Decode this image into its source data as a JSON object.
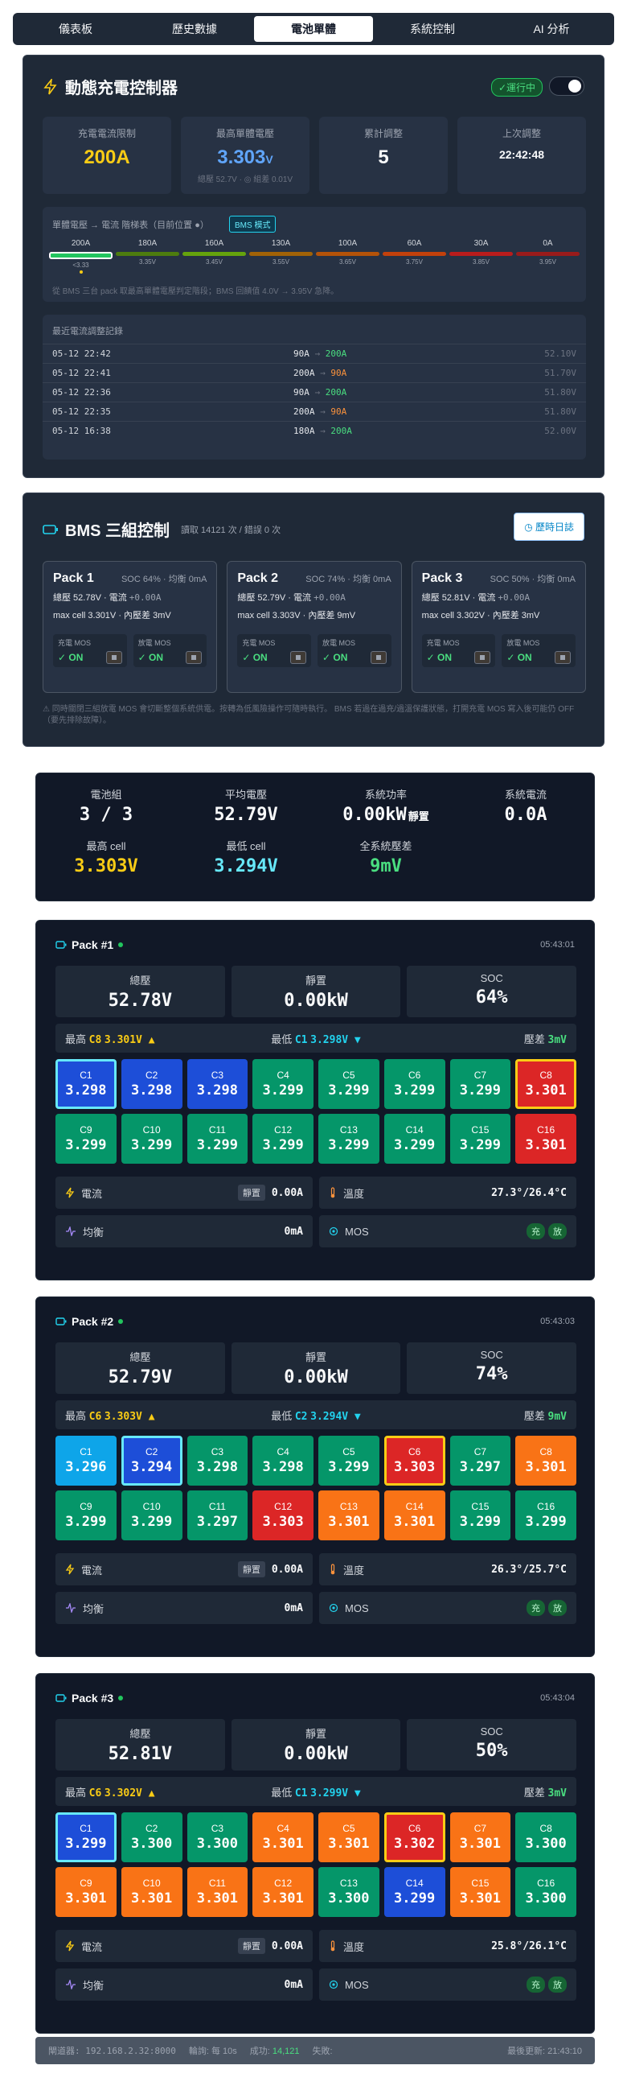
{
  "nav": {
    "tabs": [
      "儀表板",
      "歷史數據",
      "電池單體",
      "系統控制",
      "AI 分析"
    ],
    "active": 2
  },
  "charge": {
    "title": "動態充電控制器",
    "status": "✓運行中",
    "stats": [
      {
        "label": "充電電流限制",
        "value": "200A",
        "color": "#facc15",
        "sub": ""
      },
      {
        "label": "最高單體電壓",
        "value": "3.303",
        "unit": "V",
        "color": "#60a5fa",
        "sub": "總壓 52.7V · ◎ 組差 0.01V"
      },
      {
        "label": "累計調整",
        "value": "5",
        "color": "#f9fafb",
        "sub": ""
      },
      {
        "label": "上次調整",
        "value": "22:42:48",
        "color": "#f9fafb",
        "sub": ""
      }
    ],
    "ladder_title": "單體電壓 → 電流 階梯表（目前位置 ●）",
    "ladder_badge": "BMS 模式",
    "ladder": [
      {
        "a": "200A",
        "v": "<3.33",
        "color": "#22c55e",
        "cur": true
      },
      {
        "a": "180A",
        "v": "3.35V",
        "color": "#4d7c0f"
      },
      {
        "a": "160A",
        "v": "3.45V",
        "color": "#65a30d"
      },
      {
        "a": "130A",
        "v": "3.55V",
        "color": "#a16207"
      },
      {
        "a": "100A",
        "v": "3.65V",
        "color": "#b45309"
      },
      {
        "a": "60A",
        "v": "3.75V",
        "color": "#c2410c"
      },
      {
        "a": "30A",
        "v": "3.85V",
        "color": "#b91c1c"
      },
      {
        "a": "0A",
        "v": "3.95V",
        "color": "#991b1b"
      }
    ],
    "ladder_note": "從 BMS 三台 pack 取最高單體電壓判定階段；BMS 回饋值 4.0V → 3.95V 急降。",
    "log_title": "最近電流調整記錄",
    "log": [
      {
        "d": "05-12 22:42",
        "from": "90A",
        "to": "200A",
        "to_color": "#4ade80",
        "v": "52.10V"
      },
      {
        "d": "05-12 22:41",
        "from": "200A",
        "to": "90A",
        "to_color": "#fb923c",
        "v": "51.70V"
      },
      {
        "d": "05-12 22:36",
        "from": "90A",
        "to": "200A",
        "to_color": "#4ade80",
        "v": "51.80V"
      },
      {
        "d": "05-12 22:35",
        "from": "200A",
        "to": "90A",
        "to_color": "#fb923c",
        "v": "51.80V"
      },
      {
        "d": "05-12 16:38",
        "from": "180A",
        "to": "200A",
        "to_color": "#4ade80",
        "v": "52.00V"
      }
    ]
  },
  "bms": {
    "title": "BMS 三組控制",
    "sub": "讀取 14121 次 / 錯誤 0 次",
    "history_btn": "◷ 歷時日誌",
    "packs": [
      {
        "name": "Pack 1",
        "soc": "SOC 64% · 均衡 0mA",
        "l1a": "總壓 52.78V · 電流 ",
        "l1b": "+0.00A",
        "l2": "max cell 3.301V · 內壓差 3mV"
      },
      {
        "name": "Pack 2",
        "soc": "SOC 74% · 均衡 0mA",
        "l1a": "總壓 52.79V · 電流 ",
        "l1b": "+0.00A",
        "l2": "max cell 3.303V · 內壓差 9mV"
      },
      {
        "name": "Pack 3",
        "soc": "SOC 50% · 均衡 0mA",
        "l1a": "總壓 52.81V · 電流 ",
        "l1b": "+0.00A",
        "l2": "max cell 3.302V · 內壓差 3mV"
      }
    ],
    "mos_charge": "充電 MOS",
    "mos_discharge": "放電 MOS",
    "mos_on": "✓ ON",
    "warning": "⚠ 同時關閉三組放電 MOS 會切斷整個系統供電。按轉為低風險操作可隨時執行。 BMS 若過在過充/過溫保護狀態，打開充電 MOS 寫入後可能仍 OFF（要先排除故障）。"
  },
  "summary": [
    {
      "label": "電池組",
      "value": "3 / 3",
      "color": "#f9fafb"
    },
    {
      "label": "平均電壓",
      "value": "52.79V",
      "color": "#f9fafb"
    },
    {
      "label": "系統功率",
      "value": "0.00kW",
      "tag": "靜置",
      "color": "#f9fafb"
    },
    {
      "label": "系統電流",
      "value": "0.0A",
      "color": "#f9fafb"
    },
    {
      "label": "最高 cell",
      "value": "3.303V",
      "color": "#facc15"
    },
    {
      "label": "最低 cell",
      "value": "3.294V",
      "color": "#67e8f9"
    },
    {
      "label": "全系統壓差",
      "value": "9mV",
      "color": "#4ade80"
    }
  ],
  "labels": {
    "total_v": "總壓",
    "power": "靜置",
    "soc": "SOC",
    "max": "最高",
    "min": "最低",
    "diff": "壓差",
    "current": "電流",
    "idle": "靜置",
    "temp": "溫度",
    "balance": "均衡",
    "mos": "MOS",
    "chg": "充",
    "dis": "放"
  },
  "packs": [
    {
      "name": "Pack #1",
      "time": "05:43:01",
      "total": "52.78V",
      "power": "0.00kW",
      "soc": "64%",
      "max_cell": "C8",
      "max_v": "3.301V ▲",
      "min_cell": "C1",
      "min_v": "3.298V ▼",
      "diff": "3mV",
      "current": "0.00A",
      "temp": "27.3°/26.4°C",
      "balance": "0mA",
      "cells": [
        [
          "C1",
          "3.298",
          "#1d4ed8",
          "lo"
        ],
        [
          "C2",
          "3.298",
          "#1d4ed8",
          ""
        ],
        [
          "C3",
          "3.298",
          "#1d4ed8",
          ""
        ],
        [
          "C4",
          "3.299",
          "#059669",
          ""
        ],
        [
          "C5",
          "3.299",
          "#059669",
          ""
        ],
        [
          "C6",
          "3.299",
          "#059669",
          ""
        ],
        [
          "C7",
          "3.299",
          "#059669",
          ""
        ],
        [
          "C8",
          "3.301",
          "#dc2626",
          "hi"
        ],
        [
          "C9",
          "3.299",
          "#059669",
          ""
        ],
        [
          "C10",
          "3.299",
          "#059669",
          ""
        ],
        [
          "C11",
          "3.299",
          "#059669",
          ""
        ],
        [
          "C12",
          "3.299",
          "#059669",
          ""
        ],
        [
          "C13",
          "3.299",
          "#059669",
          ""
        ],
        [
          "C14",
          "3.299",
          "#059669",
          ""
        ],
        [
          "C15",
          "3.299",
          "#059669",
          ""
        ],
        [
          "C16",
          "3.301",
          "#dc2626",
          ""
        ]
      ]
    },
    {
      "name": "Pack #2",
      "time": "05:43:03",
      "total": "52.79V",
      "power": "0.00kW",
      "soc": "74%",
      "max_cell": "C6",
      "max_v": "3.303V ▲",
      "min_cell": "C2",
      "min_v": "3.294V ▼",
      "diff": "9mV",
      "current": "0.00A",
      "temp": "26.3°/25.7°C",
      "balance": "0mA",
      "cells": [
        [
          "C1",
          "3.296",
          "#0ea5e9",
          ""
        ],
        [
          "C2",
          "3.294",
          "#1d4ed8",
          "lo"
        ],
        [
          "C3",
          "3.298",
          "#059669",
          ""
        ],
        [
          "C4",
          "3.298",
          "#059669",
          ""
        ],
        [
          "C5",
          "3.299",
          "#059669",
          ""
        ],
        [
          "C6",
          "3.303",
          "#dc2626",
          "hi"
        ],
        [
          "C7",
          "3.297",
          "#059669",
          ""
        ],
        [
          "C8",
          "3.301",
          "#f97316",
          ""
        ],
        [
          "C9",
          "3.299",
          "#059669",
          ""
        ],
        [
          "C10",
          "3.299",
          "#059669",
          ""
        ],
        [
          "C11",
          "3.297",
          "#059669",
          ""
        ],
        [
          "C12",
          "3.303",
          "#dc2626",
          ""
        ],
        [
          "C13",
          "3.301",
          "#f97316",
          ""
        ],
        [
          "C14",
          "3.301",
          "#f97316",
          ""
        ],
        [
          "C15",
          "3.299",
          "#059669",
          ""
        ],
        [
          "C16",
          "3.299",
          "#059669",
          ""
        ]
      ]
    },
    {
      "name": "Pack #3",
      "time": "05:43:04",
      "total": "52.81V",
      "power": "0.00kW",
      "soc": "50%",
      "max_cell": "C6",
      "max_v": "3.302V ▲",
      "min_cell": "C1",
      "min_v": "3.299V ▼",
      "diff": "3mV",
      "current": "0.00A",
      "temp": "25.8°/26.1°C",
      "balance": "0mA",
      "cells": [
        [
          "C1",
          "3.299",
          "#1d4ed8",
          "lo"
        ],
        [
          "C2",
          "3.300",
          "#059669",
          ""
        ],
        [
          "C3",
          "3.300",
          "#059669",
          ""
        ],
        [
          "C4",
          "3.301",
          "#f97316",
          ""
        ],
        [
          "C5",
          "3.301",
          "#f97316",
          ""
        ],
        [
          "C6",
          "3.302",
          "#dc2626",
          "hi"
        ],
        [
          "C7",
          "3.301",
          "#f97316",
          ""
        ],
        [
          "C8",
          "3.300",
          "#059669",
          ""
        ],
        [
          "C9",
          "3.301",
          "#f97316",
          ""
        ],
        [
          "C10",
          "3.301",
          "#f97316",
          ""
        ],
        [
          "C11",
          "3.301",
          "#f97316",
          ""
        ],
        [
          "C12",
          "3.301",
          "#f97316",
          ""
        ],
        [
          "C13",
          "3.300",
          "#059669",
          ""
        ],
        [
          "C14",
          "3.299",
          "#1d4ed8",
          ""
        ],
        [
          "C15",
          "3.301",
          "#f97316",
          ""
        ],
        [
          "C16",
          "3.300",
          "#059669",
          ""
        ]
      ]
    }
  ],
  "footer": {
    "gateway": "閘道器: 192.168.2.32:8000",
    "poll": "輪詢: 每 10s",
    "ok_label": "成功: ",
    "ok": "14,121",
    "fail": "失敗:",
    "updated": "最後更新: 21:43:10"
  }
}
